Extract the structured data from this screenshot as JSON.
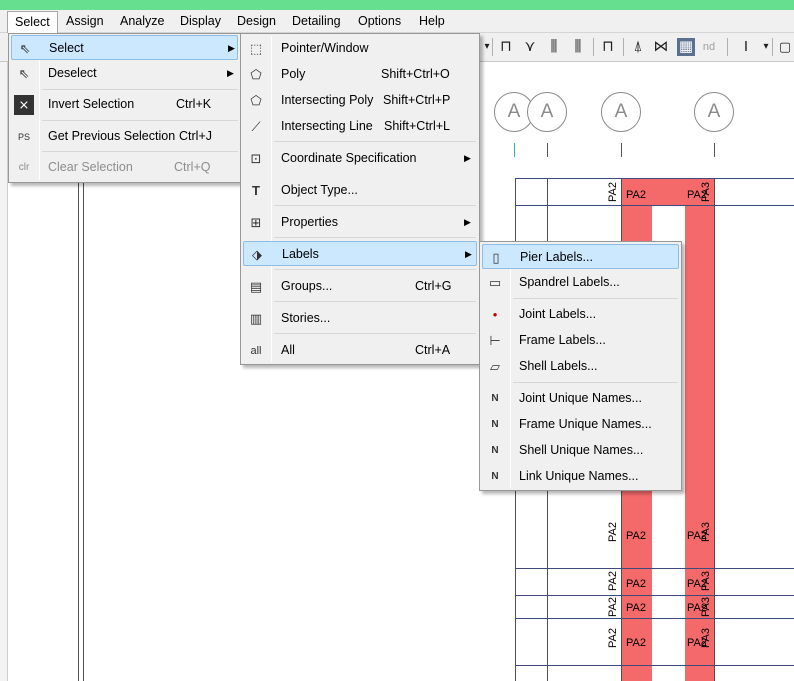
{
  "menubar": {
    "items": [
      {
        "label": "Select"
      },
      {
        "label": "Assign"
      },
      {
        "label": "Analyze"
      },
      {
        "label": "Display"
      },
      {
        "label": "Design"
      },
      {
        "label": "Detailing"
      },
      {
        "label": "Options"
      },
      {
        "label": "Help"
      }
    ]
  },
  "toolbar": {
    "nd_label": "nd"
  },
  "canvas": {
    "grid_bubbles": [
      "A",
      "A",
      "A",
      "A"
    ],
    "pier_labels": {
      "left_vertical": "PA2",
      "left_horizontal": "PA2",
      "right_vertical": "PA3",
      "right_horizontal": "PA2"
    }
  },
  "select_menu": {
    "items": [
      {
        "label": "Select",
        "shortcut": "",
        "icon": "select-cursor-icon"
      },
      {
        "label": "Deselect",
        "shortcut": "",
        "icon": "deselect-cursor-icon"
      },
      {
        "label": "Invert Selection",
        "shortcut": "Ctrl+K",
        "icon": "invert-selection-icon"
      },
      {
        "label": "Get Previous Selection",
        "shortcut": "Ctrl+J",
        "icon": "previous-selection-icon"
      },
      {
        "label": "Clear Selection",
        "shortcut": "Ctrl+Q",
        "icon": "clear-selection-icon"
      }
    ],
    "ps_text": "PS",
    "clr_text": "clr"
  },
  "select_submenu": {
    "items": [
      {
        "label": "Pointer/Window",
        "shortcut": "",
        "icon": "pointer-window-icon"
      },
      {
        "label": "Poly",
        "shortcut": "Shift+Ctrl+O",
        "icon": "poly-icon"
      },
      {
        "label": "Intersecting Poly",
        "shortcut": "Shift+Ctrl+P",
        "icon": "intersecting-poly-icon"
      },
      {
        "label": "Intersecting Line",
        "shortcut": "Shift+Ctrl+L",
        "icon": "intersecting-line-icon"
      },
      {
        "label": "Coordinate Specification",
        "shortcut": "",
        "icon": "coordinate-spec-icon"
      },
      {
        "label": "Object Type...",
        "shortcut": "",
        "icon": "object-type-icon"
      },
      {
        "label": "Properties",
        "shortcut": "",
        "icon": "properties-icon"
      },
      {
        "label": "Labels",
        "shortcut": "",
        "icon": "labels-icon"
      },
      {
        "label": "Groups...",
        "shortcut": "Ctrl+G",
        "icon": "groups-icon"
      },
      {
        "label": "Stories...",
        "shortcut": "",
        "icon": "stories-icon"
      },
      {
        "label": "All",
        "shortcut": "Ctrl+A",
        "icon": "all-icon"
      }
    ],
    "all_icon_text": "all"
  },
  "labels_submenu": {
    "items": [
      {
        "label": "Pier Labels...",
        "icon": "pier-labels-icon"
      },
      {
        "label": "Spandrel Labels...",
        "icon": "spandrel-labels-icon"
      },
      {
        "label": "Joint Labels...",
        "icon": "joint-labels-icon"
      },
      {
        "label": "Frame Labels...",
        "icon": "frame-labels-icon"
      },
      {
        "label": "Shell Labels...",
        "icon": "shell-labels-icon"
      },
      {
        "label": "Joint Unique Names...",
        "icon": "joint-unique-names-icon"
      },
      {
        "label": "Frame Unique Names...",
        "icon": "frame-unique-names-icon"
      },
      {
        "label": "Shell Unique Names...",
        "icon": "shell-unique-names-icon"
      },
      {
        "label": "Link Unique Names...",
        "icon": "link-unique-names-icon"
      }
    ],
    "n_text": "N"
  },
  "colors": {
    "pier_fill": "#f46a6a",
    "menu_highlight": "#cce8ff",
    "menu_highlight_border": "#8bbde6"
  }
}
